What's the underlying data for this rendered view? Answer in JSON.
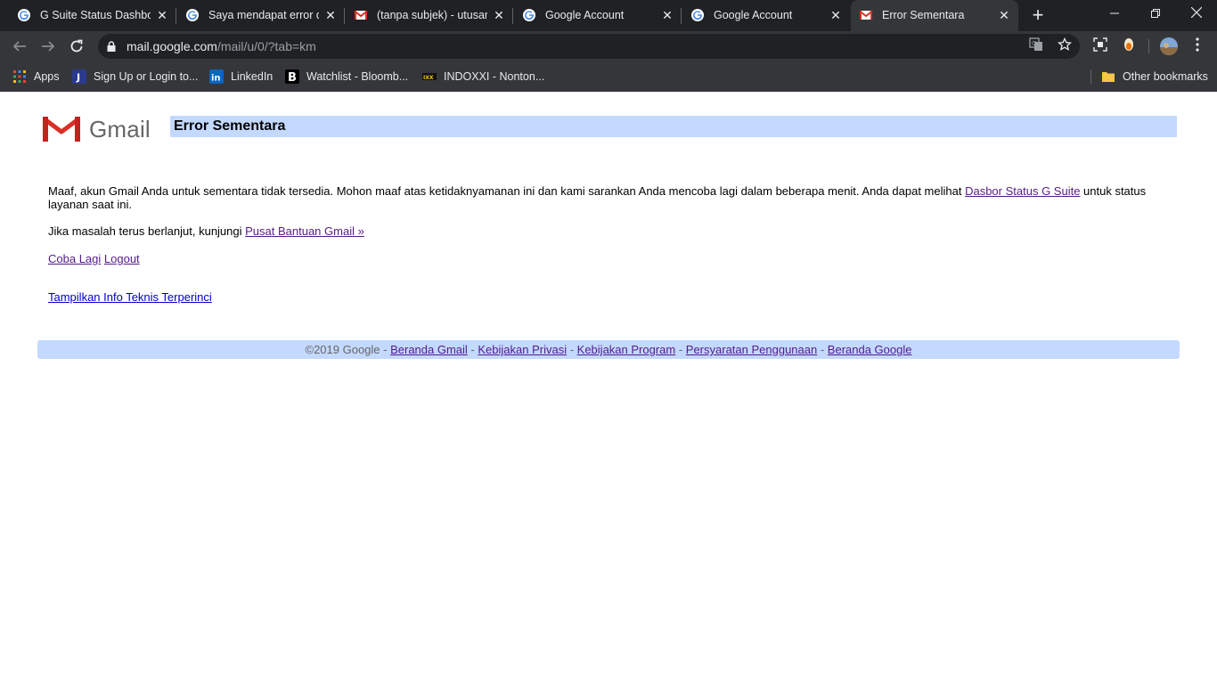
{
  "browser": {
    "tabs": [
      {
        "title": "G Suite Status Dashboa",
        "icon": "google-icon",
        "active": false
      },
      {
        "title": "Saya mendapat error di",
        "icon": "google-icon",
        "active": false
      },
      {
        "title": "(tanpa subjek) - utusan",
        "icon": "gmail-icon",
        "active": false
      },
      {
        "title": "Google Account",
        "icon": "google-icon",
        "active": false
      },
      {
        "title": "Google Account",
        "icon": "google-icon",
        "active": false
      },
      {
        "title": "Error Sementara",
        "icon": "gmail-icon",
        "active": true
      }
    ],
    "url_host": "mail.google.com",
    "url_path": "/mail/u/0/?tab=km",
    "bookmarks": [
      {
        "label": "Apps",
        "icon": "apps-grid-icon"
      },
      {
        "label": "Sign Up or Login to...",
        "icon": "j-icon"
      },
      {
        "label": "LinkedIn",
        "icon": "linkedin-icon"
      },
      {
        "label": "Watchlist - Bloomb...",
        "icon": "bloomberg-icon"
      },
      {
        "label": "INDOXXI - Nonton...",
        "icon": "indoxxi-icon"
      }
    ],
    "other_bookmarks": "Other bookmarks",
    "colors": {
      "chrome_dark": "#202124",
      "chrome_toolbar": "#35363a"
    }
  },
  "page": {
    "logo_text": "Gmail",
    "title": "Error Sementara",
    "message_part1": "Maaf, akun Gmail Anda untuk sementara tidak tersedia. Mohon maaf atas ketidaknyamanan ini dan kami sarankan Anda mencoba lagi dalam beberapa menit. Anda dapat melihat ",
    "status_link": "Dasbor Status G Suite",
    "message_part2": " untuk status layanan saat ini.",
    "help_prefix": "Jika masalah terus berlanjut, kunjungi ",
    "help_link": "Pusat Bantuan Gmail »",
    "retry_link": "Coba Lagi",
    "logout_link": "Logout",
    "details_link": "Tampilkan Info Teknis Terperinci",
    "colors": {
      "title_bar": "#c3d9ff",
      "link_visited": "#551a8b",
      "link": "#0000cc"
    }
  },
  "footer": {
    "copyright": "©2019 Google - ",
    "links": [
      "Beranda Gmail",
      "Kebijakan Privasi",
      "Kebijakan Program",
      "Persyaratan Penggunaan",
      "Beranda Google"
    ],
    "separator": " - "
  }
}
